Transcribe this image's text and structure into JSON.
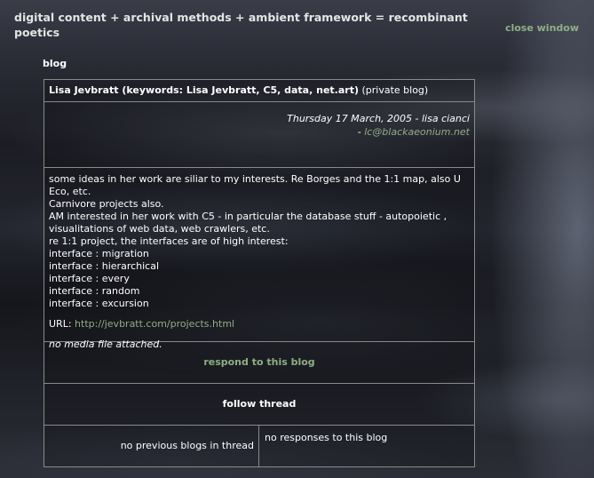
{
  "header": {
    "title": "digital content + archival methods + ambient framework = recombinant poetics",
    "close_label": "close window"
  },
  "section_label": "blog",
  "blog": {
    "heading_bold": "Lisa Jevbratt (keywords: Lisa Jevbratt, C5, data, net.art)",
    "heading_note": "(private blog)",
    "date_author": "Thursday 17 March, 2005 - lisa cianci",
    "email_prefix": "- ",
    "email": "lc@blackaeonium.net",
    "body_lines": [
      "some ideas in her work are siliar to my interests. Re Borges and the 1:1 map, also U Eco, etc.",
      "Carnivore projects also.",
      "AM interested in her work with C5 - in particular the database stuff - autopoietic , visualitations of web data, web crawlers, etc.",
      "re 1:1 project, the interfaces are of high interest:",
      "interface : migration",
      "interface : hierarchical",
      "interface : every",
      "interface : random",
      "interface : excursion"
    ],
    "url_label": "URL:",
    "url": "http://jevbratt.com/projects.html",
    "media_note": "no media file attached."
  },
  "actions": {
    "respond_label": "respond to this blog",
    "follow_label": "follow thread",
    "prev_label": "no previous blogs in thread",
    "next_label": "no responses to this blog"
  },
  "colors": {
    "link": "#8fae86",
    "border": "#8a8a8a",
    "text": "#ffffff"
  }
}
